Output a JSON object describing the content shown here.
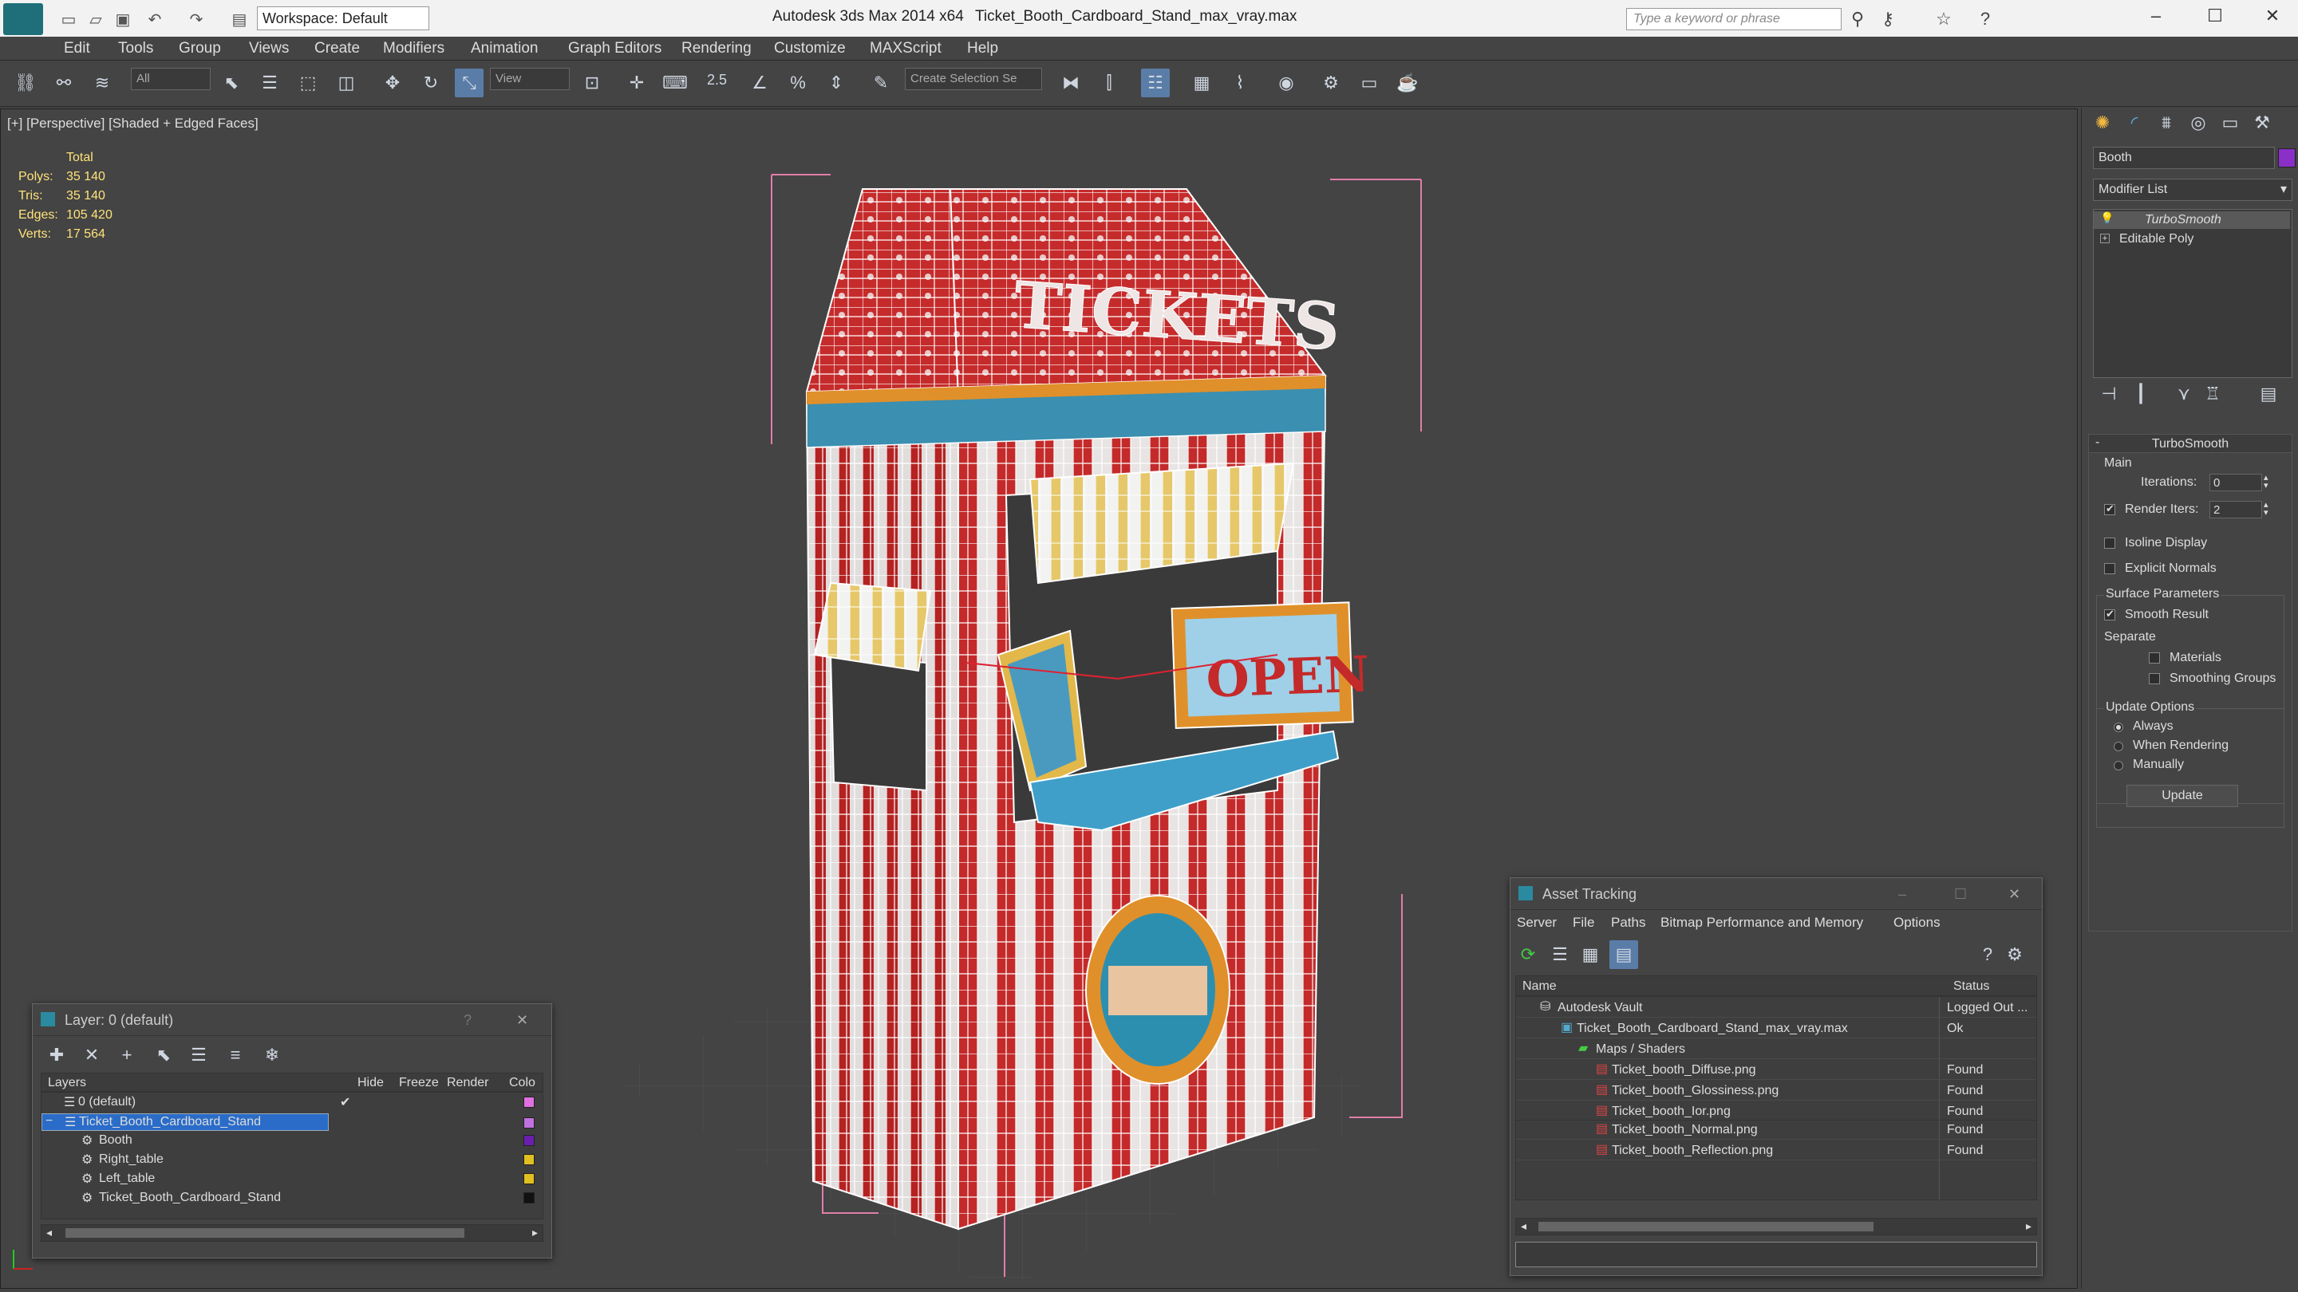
{
  "titlebar": {
    "workspace": "Workspace: Default",
    "app_title": "Autodesk 3ds Max 2014 x64",
    "file_title": "Ticket_Booth_Cardboard_Stand_max_vray.max",
    "search_placeholder": "Type a keyword or phrase"
  },
  "menu": [
    "Edit",
    "Tools",
    "Group",
    "Views",
    "Create",
    "Modifiers",
    "Animation",
    "Graph Editors",
    "Rendering",
    "Customize",
    "MAXScript",
    "Help"
  ],
  "toolbar": {
    "filter": "All",
    "ref_coord": "View",
    "snap_label": "2.5",
    "selection_set": "Create Selection Se"
  },
  "viewport": {
    "label": "[+] [Perspective] [Shaded + Edged Faces]",
    "stats_header": "Total",
    "stats": [
      {
        "label": "Polys:",
        "value": "35 140"
      },
      {
        "label": "Tris:",
        "value": "35 140"
      },
      {
        "label": "Edges:",
        "value": "105 420"
      },
      {
        "label": "Verts:",
        "value": "17 564"
      }
    ],
    "sign_tickets": "TICKETS",
    "sign_open": "OPEN"
  },
  "command_panel": {
    "object_name": "Booth",
    "object_color": "#8b2fc9",
    "modifier_list": "Modifier List",
    "stack": [
      "TurboSmooth",
      "Editable Poly"
    ],
    "rollout_title": "TurboSmooth",
    "main_group": "Main",
    "iterations_label": "Iterations:",
    "iterations_value": "0",
    "render_iters_label": "Render Iters:",
    "render_iters_value": "2",
    "isoline": "Isoline Display",
    "explicit_normals": "Explicit Normals",
    "surface_params": "Surface Parameters",
    "smooth_result": "Smooth Result",
    "separate": "Separate",
    "materials": "Materials",
    "smoothing_groups": "Smoothing Groups",
    "update_options": "Update Options",
    "always": "Always",
    "when_rendering": "When Rendering",
    "manually": "Manually",
    "update_button": "Update"
  },
  "layer_window": {
    "title": "Layer: 0 (default)",
    "columns": [
      "Layers",
      "Hide",
      "Freeze",
      "Render",
      "Colo"
    ],
    "rows": [
      {
        "name": "0 (default)",
        "color": "#e070e0"
      },
      {
        "name": "Ticket_Booth_Cardboard_Stand",
        "color": "#c070e0"
      },
      {
        "name": "Booth",
        "color": "#6a1fb0"
      },
      {
        "name": "Right_table",
        "color": "#e0c020"
      },
      {
        "name": "Left_table",
        "color": "#e0c020"
      },
      {
        "name": "Ticket_Booth_Cardboard_Stand",
        "color": "#111111"
      }
    ]
  },
  "asset_window": {
    "title": "Asset Tracking",
    "menu": [
      "Server",
      "File",
      "Paths",
      "Bitmap Performance and Memory",
      "Options"
    ],
    "columns": [
      "Name",
      "Status"
    ],
    "rows": [
      {
        "name": "Autodesk Vault",
        "status": "Logged Out ..."
      },
      {
        "name": "Ticket_Booth_Cardboard_Stand_max_vray.max",
        "status": "Ok"
      },
      {
        "name": "Maps / Shaders",
        "status": ""
      },
      {
        "name": "Ticket_booth_Diffuse.png",
        "status": "Found"
      },
      {
        "name": "Ticket_booth_Glossiness.png",
        "status": "Found"
      },
      {
        "name": "Ticket_booth_Ior.png",
        "status": "Found"
      },
      {
        "name": "Ticket_booth_Normal.png",
        "status": "Found"
      },
      {
        "name": "Ticket_booth_Reflection.png",
        "status": "Found"
      }
    ]
  }
}
